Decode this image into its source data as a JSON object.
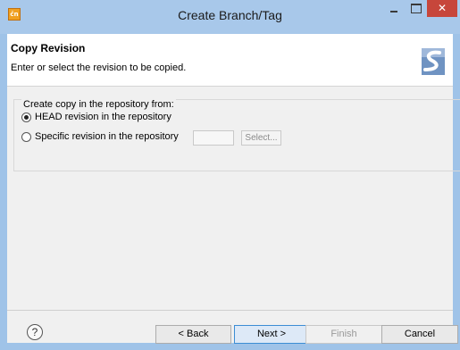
{
  "window": {
    "title": "Create Branch/Tag",
    "app_icon_text": "c̄n",
    "close_glyph": "✕"
  },
  "banner": {
    "title": "Copy Revision",
    "description": "Enter or select the revision to be copied.",
    "graphic": "subversion-wizard-graphic"
  },
  "group": {
    "label": "Create copy in the repository from:",
    "options": [
      {
        "label": "HEAD revision in the repository",
        "selected": true
      },
      {
        "label": "Specific revision in the repository",
        "selected": false
      }
    ],
    "revision_value": "",
    "select_label": "Select..."
  },
  "footer": {
    "help_glyph": "?",
    "back_label": "< Back",
    "next_label": "Next >",
    "finish_label": "Finish",
    "cancel_label": "Cancel"
  },
  "colors": {
    "title_bar": "#a8c8ea",
    "close_button": "#c7463b",
    "content_bg": "#f0f0f0"
  }
}
